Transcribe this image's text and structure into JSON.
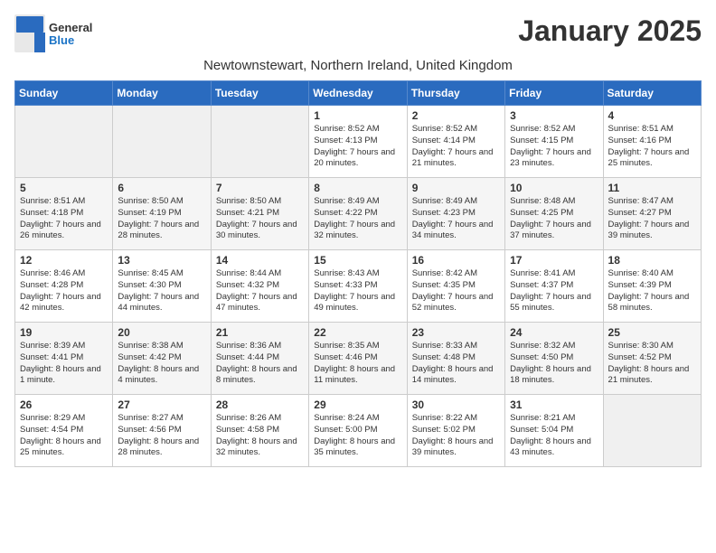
{
  "header": {
    "logo": {
      "general": "General",
      "blue": "Blue"
    },
    "title": "January 2025",
    "subtitle": "Newtownstewart, Northern Ireland, United Kingdom"
  },
  "days_of_week": [
    "Sunday",
    "Monday",
    "Tuesday",
    "Wednesday",
    "Thursday",
    "Friday",
    "Saturday"
  ],
  "weeks": [
    [
      {
        "day": "",
        "empty": true
      },
      {
        "day": "",
        "empty": true
      },
      {
        "day": "",
        "empty": true
      },
      {
        "day": "1",
        "sunrise": "Sunrise: 8:52 AM",
        "sunset": "Sunset: 4:13 PM",
        "daylight": "Daylight: 7 hours and 20 minutes."
      },
      {
        "day": "2",
        "sunrise": "Sunrise: 8:52 AM",
        "sunset": "Sunset: 4:14 PM",
        "daylight": "Daylight: 7 hours and 21 minutes."
      },
      {
        "day": "3",
        "sunrise": "Sunrise: 8:52 AM",
        "sunset": "Sunset: 4:15 PM",
        "daylight": "Daylight: 7 hours and 23 minutes."
      },
      {
        "day": "4",
        "sunrise": "Sunrise: 8:51 AM",
        "sunset": "Sunset: 4:16 PM",
        "daylight": "Daylight: 7 hours and 25 minutes."
      }
    ],
    [
      {
        "day": "5",
        "sunrise": "Sunrise: 8:51 AM",
        "sunset": "Sunset: 4:18 PM",
        "daylight": "Daylight: 7 hours and 26 minutes."
      },
      {
        "day": "6",
        "sunrise": "Sunrise: 8:50 AM",
        "sunset": "Sunset: 4:19 PM",
        "daylight": "Daylight: 7 hours and 28 minutes."
      },
      {
        "day": "7",
        "sunrise": "Sunrise: 8:50 AM",
        "sunset": "Sunset: 4:21 PM",
        "daylight": "Daylight: 7 hours and 30 minutes."
      },
      {
        "day": "8",
        "sunrise": "Sunrise: 8:49 AM",
        "sunset": "Sunset: 4:22 PM",
        "daylight": "Daylight: 7 hours and 32 minutes."
      },
      {
        "day": "9",
        "sunrise": "Sunrise: 8:49 AM",
        "sunset": "Sunset: 4:23 PM",
        "daylight": "Daylight: 7 hours and 34 minutes."
      },
      {
        "day": "10",
        "sunrise": "Sunrise: 8:48 AM",
        "sunset": "Sunset: 4:25 PM",
        "daylight": "Daylight: 7 hours and 37 minutes."
      },
      {
        "day": "11",
        "sunrise": "Sunrise: 8:47 AM",
        "sunset": "Sunset: 4:27 PM",
        "daylight": "Daylight: 7 hours and 39 minutes."
      }
    ],
    [
      {
        "day": "12",
        "sunrise": "Sunrise: 8:46 AM",
        "sunset": "Sunset: 4:28 PM",
        "daylight": "Daylight: 7 hours and 42 minutes."
      },
      {
        "day": "13",
        "sunrise": "Sunrise: 8:45 AM",
        "sunset": "Sunset: 4:30 PM",
        "daylight": "Daylight: 7 hours and 44 minutes."
      },
      {
        "day": "14",
        "sunrise": "Sunrise: 8:44 AM",
        "sunset": "Sunset: 4:32 PM",
        "daylight": "Daylight: 7 hours and 47 minutes."
      },
      {
        "day": "15",
        "sunrise": "Sunrise: 8:43 AM",
        "sunset": "Sunset: 4:33 PM",
        "daylight": "Daylight: 7 hours and 49 minutes."
      },
      {
        "day": "16",
        "sunrise": "Sunrise: 8:42 AM",
        "sunset": "Sunset: 4:35 PM",
        "daylight": "Daylight: 7 hours and 52 minutes."
      },
      {
        "day": "17",
        "sunrise": "Sunrise: 8:41 AM",
        "sunset": "Sunset: 4:37 PM",
        "daylight": "Daylight: 7 hours and 55 minutes."
      },
      {
        "day": "18",
        "sunrise": "Sunrise: 8:40 AM",
        "sunset": "Sunset: 4:39 PM",
        "daylight": "Daylight: 7 hours and 58 minutes."
      }
    ],
    [
      {
        "day": "19",
        "sunrise": "Sunrise: 8:39 AM",
        "sunset": "Sunset: 4:41 PM",
        "daylight": "Daylight: 8 hours and 1 minute."
      },
      {
        "day": "20",
        "sunrise": "Sunrise: 8:38 AM",
        "sunset": "Sunset: 4:42 PM",
        "daylight": "Daylight: 8 hours and 4 minutes."
      },
      {
        "day": "21",
        "sunrise": "Sunrise: 8:36 AM",
        "sunset": "Sunset: 4:44 PM",
        "daylight": "Daylight: 8 hours and 8 minutes."
      },
      {
        "day": "22",
        "sunrise": "Sunrise: 8:35 AM",
        "sunset": "Sunset: 4:46 PM",
        "daylight": "Daylight: 8 hours and 11 minutes."
      },
      {
        "day": "23",
        "sunrise": "Sunrise: 8:33 AM",
        "sunset": "Sunset: 4:48 PM",
        "daylight": "Daylight: 8 hours and 14 minutes."
      },
      {
        "day": "24",
        "sunrise": "Sunrise: 8:32 AM",
        "sunset": "Sunset: 4:50 PM",
        "daylight": "Daylight: 8 hours and 18 minutes."
      },
      {
        "day": "25",
        "sunrise": "Sunrise: 8:30 AM",
        "sunset": "Sunset: 4:52 PM",
        "daylight": "Daylight: 8 hours and 21 minutes."
      }
    ],
    [
      {
        "day": "26",
        "sunrise": "Sunrise: 8:29 AM",
        "sunset": "Sunset: 4:54 PM",
        "daylight": "Daylight: 8 hours and 25 minutes."
      },
      {
        "day": "27",
        "sunrise": "Sunrise: 8:27 AM",
        "sunset": "Sunset: 4:56 PM",
        "daylight": "Daylight: 8 hours and 28 minutes."
      },
      {
        "day": "28",
        "sunrise": "Sunrise: 8:26 AM",
        "sunset": "Sunset: 4:58 PM",
        "daylight": "Daylight: 8 hours and 32 minutes."
      },
      {
        "day": "29",
        "sunrise": "Sunrise: 8:24 AM",
        "sunset": "Sunset: 5:00 PM",
        "daylight": "Daylight: 8 hours and 35 minutes."
      },
      {
        "day": "30",
        "sunrise": "Sunrise: 8:22 AM",
        "sunset": "Sunset: 5:02 PM",
        "daylight": "Daylight: 8 hours and 39 minutes."
      },
      {
        "day": "31",
        "sunrise": "Sunrise: 8:21 AM",
        "sunset": "Sunset: 5:04 PM",
        "daylight": "Daylight: 8 hours and 43 minutes."
      },
      {
        "day": "",
        "empty": true
      }
    ]
  ]
}
